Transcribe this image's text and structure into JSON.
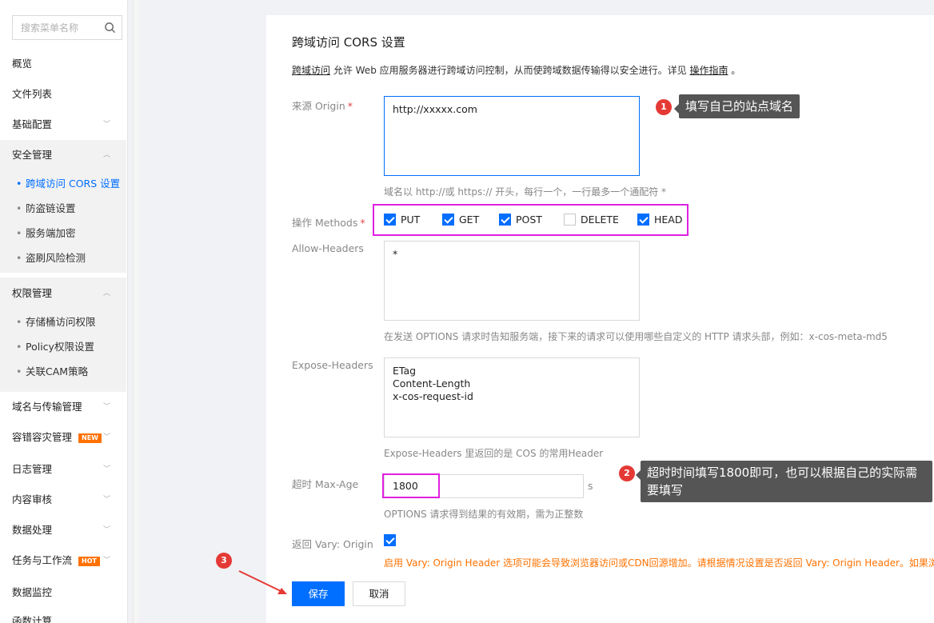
{
  "sidebar": {
    "search_placeholder": "搜索菜单名称",
    "items": [
      {
        "label": "概览"
      },
      {
        "label": "文件列表"
      },
      {
        "label": "基础配置"
      },
      {
        "label": "安全管理"
      },
      {
        "label": "权限管理"
      },
      {
        "label": "域名与传输管理"
      },
      {
        "label": "容错容灾管理",
        "badge": "NEW"
      },
      {
        "label": "日志管理"
      },
      {
        "label": "内容审核"
      },
      {
        "label": "数据处理"
      },
      {
        "label": "任务与工作流",
        "badge": "HOT"
      },
      {
        "label": "数据监控"
      },
      {
        "label": "函数计算"
      }
    ],
    "security_sub": [
      "跨域访问 CORS 设置",
      "防盗链设置",
      "服务端加密",
      "盗刷风险检测"
    ],
    "permission_sub": [
      "存储桶访问权限",
      "Policy权限设置",
      "关联CAM策略"
    ]
  },
  "form": {
    "title": "跨域访问 CORS 设置",
    "desc_link": "跨域访问",
    "desc_text": " 允许 Web 应用服务器进行跨域访问控制，从而使跨域数据传输得以安全进行。详见 ",
    "desc_link2": "操作指南",
    "desc_end": " 。",
    "origin_label": "来源 Origin",
    "origin_value": "http://xxxxx.com",
    "origin_hint": "域名以 http://或 https:// 开头，每行一个，一行最多一个通配符 *",
    "methods_label": "操作 Methods",
    "methods": [
      {
        "label": "PUT",
        "checked": true
      },
      {
        "label": "GET",
        "checked": true
      },
      {
        "label": "POST",
        "checked": true
      },
      {
        "label": "DELETE",
        "checked": false
      },
      {
        "label": "HEAD",
        "checked": true
      }
    ],
    "allow_headers_label": "Allow-Headers",
    "allow_headers_value": "*",
    "allow_headers_hint": "在发送 OPTIONS 请求时告知服务端，接下来的请求可以使用哪些自定义的 HTTP 请求头部，例如：x-cos-meta-md5",
    "expose_headers_label": "Expose-Headers",
    "expose_headers_value": "ETag\nContent-Length\nx-cos-request-id",
    "expose_headers_hint": "Expose-Headers 里返回的是 COS 的常用Header",
    "max_age_label": "超时 Max-Age",
    "max_age_value": "1800",
    "max_age_unit": "s",
    "max_age_hint": "OPTIONS 请求得到结果的有效期，需为正整数",
    "vary_label": "返回 Vary: Origin",
    "vary_checked": true,
    "vary_hint": "启用 Vary: Origin Header 选项可能会导致浏览器访问或CDN回源增加。请根据情况设置是否返回 Vary: Origin Header。如果浏",
    "save_label": "保存",
    "cancel_label": "取消"
  },
  "annotations": {
    "n1": "1",
    "tip1": "填写自己的站点域名",
    "n2": "2",
    "tip2": "超时时间填写1800即可，也可以根据自己的实际需要填写",
    "n3": "3",
    "highlight_color": "#e020e0",
    "marker_color": "#e53935"
  },
  "colors": {
    "primary": "#006eff",
    "warn": "#ff7200",
    "required": "#e54545"
  }
}
